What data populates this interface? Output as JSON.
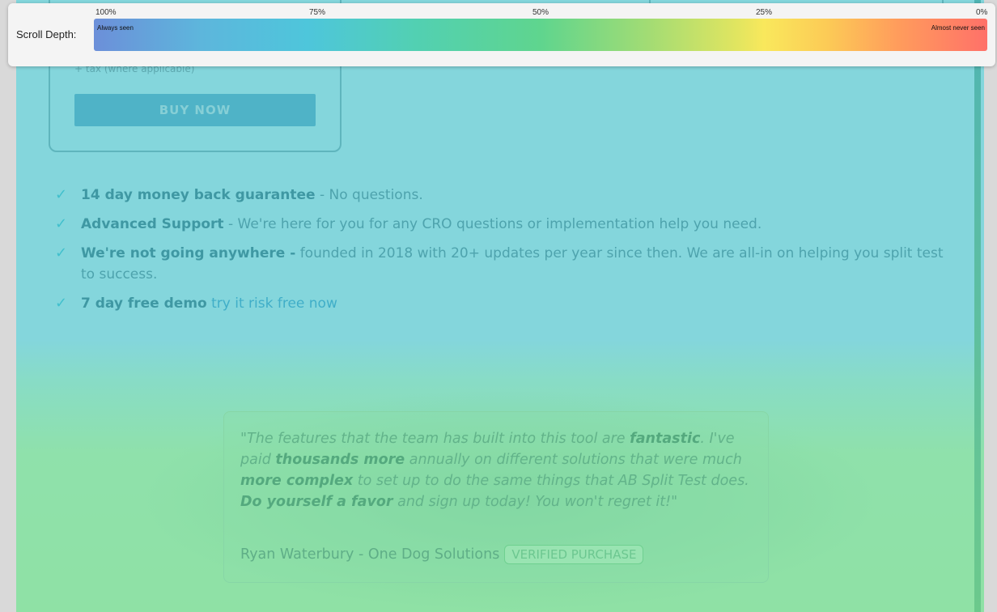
{
  "pricing": {
    "tax_note": "+ tax (where applicable)",
    "buy_label": "BUY NOW"
  },
  "benefits": [
    {
      "bold": "14 day money back guarantee",
      "text": " - No questions.",
      "link": ""
    },
    {
      "bold": "Advanced Support",
      "text": " - We're here for you for any CRO questions or implementation help you need.",
      "link": ""
    },
    {
      "bold": "We're not going anywhere -",
      "text": " founded in 2018 with 20+ updates per year since then. We are all-in on helping you split test to success.",
      "link": ""
    },
    {
      "bold": "7 day free demo",
      "text": " ",
      "link": "try it risk free now"
    }
  ],
  "testimonial": {
    "q1": "\"The features that the team has built into this tool are ",
    "b1": "fantastic",
    "q2": ". I've paid ",
    "b2": "thousands more",
    "q3": " annually on different solutions that were much ",
    "b3": "more complex",
    "q4": " to set up to do the same things that AB Split Test does. ",
    "b4": "Do yourself a favor",
    "q5": " and sign up today! You won't regret it!\"",
    "author": "Ryan Waterbury - One Dog Solutions",
    "badge": "VERIFIED PURCHASE"
  },
  "scroll_depth": {
    "label": "Scroll Depth:",
    "ticks": [
      "100%",
      "75%",
      "50%",
      "25%",
      "0%"
    ],
    "start_note": "Always seen",
    "end_note": "Almost never seen"
  },
  "colors": {
    "heat_top": "#84d6dc",
    "heat_bottom": "#8fe1a5",
    "check": "#41c0cd"
  }
}
